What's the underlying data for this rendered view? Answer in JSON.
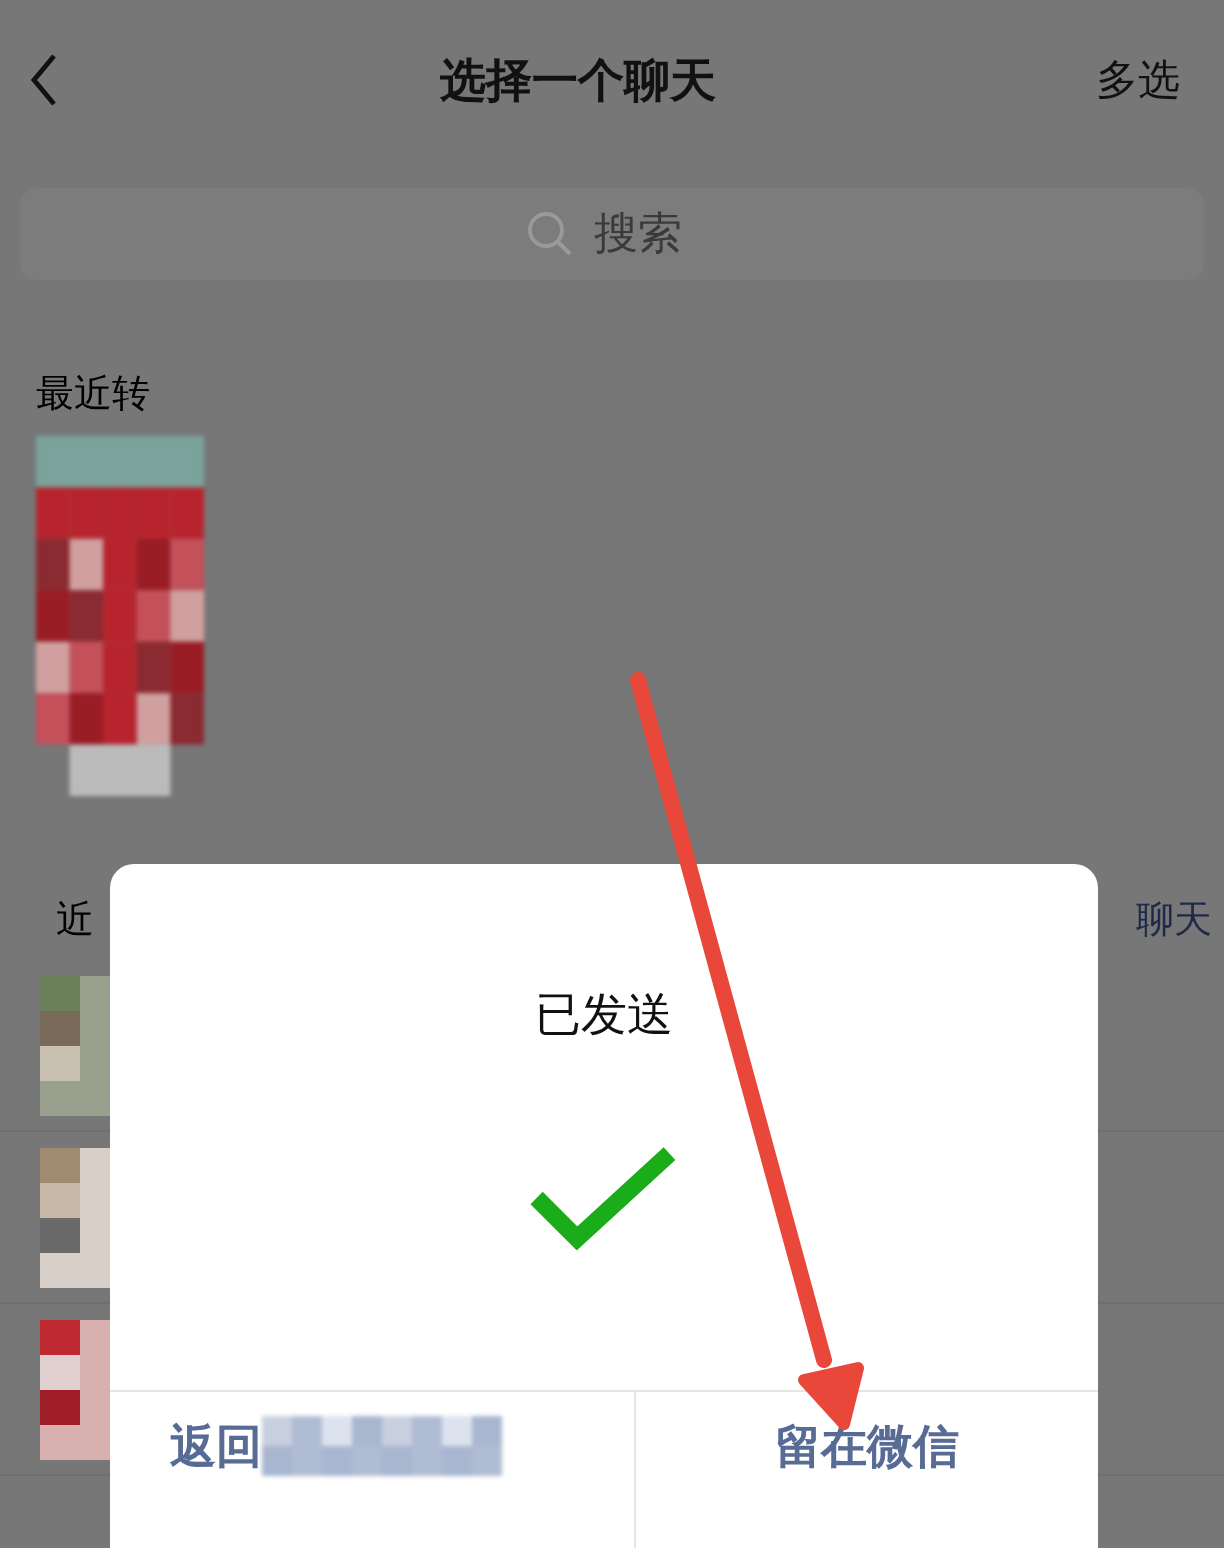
{
  "header": {
    "title": "选择一个聊天",
    "action": "多选"
  },
  "search": {
    "placeholder": "搜索"
  },
  "sections": [
    {
      "heading": "最近转"
    },
    {
      "heading": "近",
      "action": "聊天"
    }
  ],
  "dialog": {
    "title": "已发送",
    "buttons": [
      {
        "label": "返回",
        "blurred": true
      },
      {
        "label": "留在微信",
        "blurred": false
      }
    ]
  }
}
